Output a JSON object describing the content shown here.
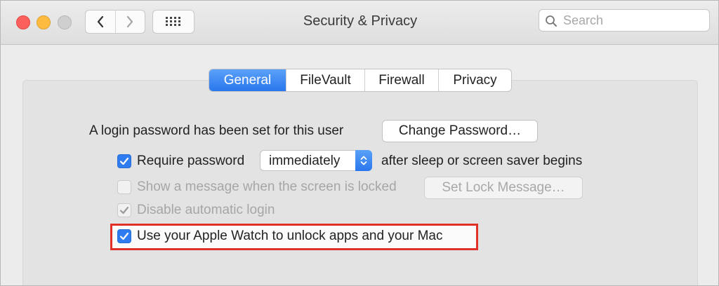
{
  "window": {
    "title": "Security & Privacy",
    "search": {
      "placeholder": "Search",
      "value": ""
    }
  },
  "tabs": [
    {
      "label": "General",
      "active": true
    },
    {
      "label": "FileVault",
      "active": false
    },
    {
      "label": "Firewall",
      "active": false
    },
    {
      "label": "Privacy",
      "active": false
    }
  ],
  "general": {
    "login_text": "A login password has been set for this user",
    "change_password_label": "Change Password…",
    "require_password": {
      "label": "Require password",
      "checked": true
    },
    "delay_value": "immediately",
    "after_text": "after sleep or screen saver begins",
    "show_message": {
      "label": "Show a message when the screen is locked",
      "checked": false,
      "enabled": false
    },
    "set_lock_label": "Set Lock Message…",
    "disable_autologin": {
      "label": "Disable automatic login",
      "checked": true,
      "enabled": false
    },
    "apple_watch": {
      "label": "Use your Apple Watch to unlock apps and your Mac",
      "checked": true
    }
  },
  "colors": {
    "accent": "#2f7cf0",
    "highlight_border": "#e1322a",
    "close": "#fc605c",
    "minimize": "#fdbc40",
    "zoom_disabled": "#cfcfcf"
  }
}
